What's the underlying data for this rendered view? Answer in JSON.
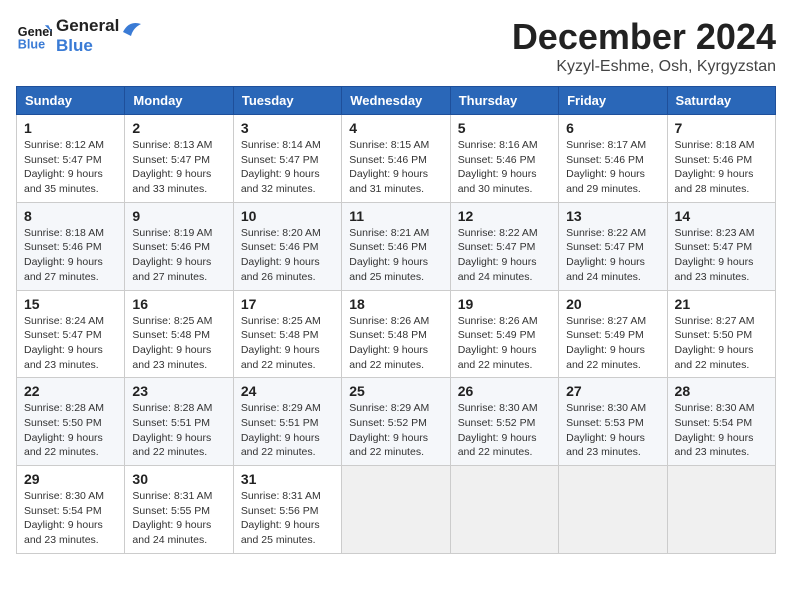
{
  "header": {
    "logo_line1": "General",
    "logo_line2": "Blue",
    "month_title": "December 2024",
    "location": "Kyzyl-Eshme, Osh, Kyrgyzstan"
  },
  "weekdays": [
    "Sunday",
    "Monday",
    "Tuesday",
    "Wednesday",
    "Thursday",
    "Friday",
    "Saturday"
  ],
  "weeks": [
    [
      {
        "day": "1",
        "sunrise": "Sunrise: 8:12 AM",
        "sunset": "Sunset: 5:47 PM",
        "daylight": "Daylight: 9 hours and 35 minutes."
      },
      {
        "day": "2",
        "sunrise": "Sunrise: 8:13 AM",
        "sunset": "Sunset: 5:47 PM",
        "daylight": "Daylight: 9 hours and 33 minutes."
      },
      {
        "day": "3",
        "sunrise": "Sunrise: 8:14 AM",
        "sunset": "Sunset: 5:47 PM",
        "daylight": "Daylight: 9 hours and 32 minutes."
      },
      {
        "day": "4",
        "sunrise": "Sunrise: 8:15 AM",
        "sunset": "Sunset: 5:46 PM",
        "daylight": "Daylight: 9 hours and 31 minutes."
      },
      {
        "day": "5",
        "sunrise": "Sunrise: 8:16 AM",
        "sunset": "Sunset: 5:46 PM",
        "daylight": "Daylight: 9 hours and 30 minutes."
      },
      {
        "day": "6",
        "sunrise": "Sunrise: 8:17 AM",
        "sunset": "Sunset: 5:46 PM",
        "daylight": "Daylight: 9 hours and 29 minutes."
      },
      {
        "day": "7",
        "sunrise": "Sunrise: 8:18 AM",
        "sunset": "Sunset: 5:46 PM",
        "daylight": "Daylight: 9 hours and 28 minutes."
      }
    ],
    [
      {
        "day": "8",
        "sunrise": "Sunrise: 8:18 AM",
        "sunset": "Sunset: 5:46 PM",
        "daylight": "Daylight: 9 hours and 27 minutes."
      },
      {
        "day": "9",
        "sunrise": "Sunrise: 8:19 AM",
        "sunset": "Sunset: 5:46 PM",
        "daylight": "Daylight: 9 hours and 27 minutes."
      },
      {
        "day": "10",
        "sunrise": "Sunrise: 8:20 AM",
        "sunset": "Sunset: 5:46 PM",
        "daylight": "Daylight: 9 hours and 26 minutes."
      },
      {
        "day": "11",
        "sunrise": "Sunrise: 8:21 AM",
        "sunset": "Sunset: 5:46 PM",
        "daylight": "Daylight: 9 hours and 25 minutes."
      },
      {
        "day": "12",
        "sunrise": "Sunrise: 8:22 AM",
        "sunset": "Sunset: 5:47 PM",
        "daylight": "Daylight: 9 hours and 24 minutes."
      },
      {
        "day": "13",
        "sunrise": "Sunrise: 8:22 AM",
        "sunset": "Sunset: 5:47 PM",
        "daylight": "Daylight: 9 hours and 24 minutes."
      },
      {
        "day": "14",
        "sunrise": "Sunrise: 8:23 AM",
        "sunset": "Sunset: 5:47 PM",
        "daylight": "Daylight: 9 hours and 23 minutes."
      }
    ],
    [
      {
        "day": "15",
        "sunrise": "Sunrise: 8:24 AM",
        "sunset": "Sunset: 5:47 PM",
        "daylight": "Daylight: 9 hours and 23 minutes."
      },
      {
        "day": "16",
        "sunrise": "Sunrise: 8:25 AM",
        "sunset": "Sunset: 5:48 PM",
        "daylight": "Daylight: 9 hours and 23 minutes."
      },
      {
        "day": "17",
        "sunrise": "Sunrise: 8:25 AM",
        "sunset": "Sunset: 5:48 PM",
        "daylight": "Daylight: 9 hours and 22 minutes."
      },
      {
        "day": "18",
        "sunrise": "Sunrise: 8:26 AM",
        "sunset": "Sunset: 5:48 PM",
        "daylight": "Daylight: 9 hours and 22 minutes."
      },
      {
        "day": "19",
        "sunrise": "Sunrise: 8:26 AM",
        "sunset": "Sunset: 5:49 PM",
        "daylight": "Daylight: 9 hours and 22 minutes."
      },
      {
        "day": "20",
        "sunrise": "Sunrise: 8:27 AM",
        "sunset": "Sunset: 5:49 PM",
        "daylight": "Daylight: 9 hours and 22 minutes."
      },
      {
        "day": "21",
        "sunrise": "Sunrise: 8:27 AM",
        "sunset": "Sunset: 5:50 PM",
        "daylight": "Daylight: 9 hours and 22 minutes."
      }
    ],
    [
      {
        "day": "22",
        "sunrise": "Sunrise: 8:28 AM",
        "sunset": "Sunset: 5:50 PM",
        "daylight": "Daylight: 9 hours and 22 minutes."
      },
      {
        "day": "23",
        "sunrise": "Sunrise: 8:28 AM",
        "sunset": "Sunset: 5:51 PM",
        "daylight": "Daylight: 9 hours and 22 minutes."
      },
      {
        "day": "24",
        "sunrise": "Sunrise: 8:29 AM",
        "sunset": "Sunset: 5:51 PM",
        "daylight": "Daylight: 9 hours and 22 minutes."
      },
      {
        "day": "25",
        "sunrise": "Sunrise: 8:29 AM",
        "sunset": "Sunset: 5:52 PM",
        "daylight": "Daylight: 9 hours and 22 minutes."
      },
      {
        "day": "26",
        "sunrise": "Sunrise: 8:30 AM",
        "sunset": "Sunset: 5:52 PM",
        "daylight": "Daylight: 9 hours and 22 minutes."
      },
      {
        "day": "27",
        "sunrise": "Sunrise: 8:30 AM",
        "sunset": "Sunset: 5:53 PM",
        "daylight": "Daylight: 9 hours and 23 minutes."
      },
      {
        "day": "28",
        "sunrise": "Sunrise: 8:30 AM",
        "sunset": "Sunset: 5:54 PM",
        "daylight": "Daylight: 9 hours and 23 minutes."
      }
    ],
    [
      {
        "day": "29",
        "sunrise": "Sunrise: 8:30 AM",
        "sunset": "Sunset: 5:54 PM",
        "daylight": "Daylight: 9 hours and 23 minutes."
      },
      {
        "day": "30",
        "sunrise": "Sunrise: 8:31 AM",
        "sunset": "Sunset: 5:55 PM",
        "daylight": "Daylight: 9 hours and 24 minutes."
      },
      {
        "day": "31",
        "sunrise": "Sunrise: 8:31 AM",
        "sunset": "Sunset: 5:56 PM",
        "daylight": "Daylight: 9 hours and 25 minutes."
      },
      null,
      null,
      null,
      null
    ]
  ]
}
